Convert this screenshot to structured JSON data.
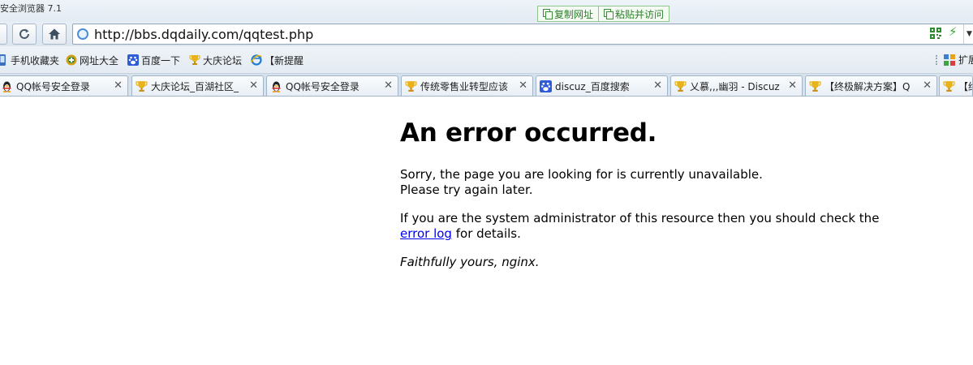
{
  "browser": {
    "title": "安全浏览器 7.1",
    "copy_url_label": "复制网址",
    "paste_go_label": "粘贴并访问",
    "url": "http://bbs.dqdaily.com/qqtest.php"
  },
  "favorites": {
    "items": [
      {
        "label": "手机收藏夹",
        "icon": "phone-icon"
      },
      {
        "label": "网址大全",
        "icon": "site-directory-icon"
      },
      {
        "label": "百度一下",
        "icon": "baidu-paw-icon"
      },
      {
        "label": "大庆论坛",
        "icon": "trophy-icon"
      },
      {
        "label": "【新提醒",
        "icon": "ie-icon"
      }
    ],
    "extend_label": "扩展"
  },
  "tabs": [
    {
      "label": "QQ帐号安全登录",
      "icon": "qq-penguin-icon"
    },
    {
      "label": "大庆论坛_百湖社区_",
      "icon": "trophy-icon"
    },
    {
      "label": "QQ帐号安全登录",
      "icon": "qq-penguin-icon"
    },
    {
      "label": "传统零售业转型应该",
      "icon": "trophy-icon"
    },
    {
      "label": "discuz_百度搜索",
      "icon": "baidu-paw-icon"
    },
    {
      "label": "乂慕,,,幽羽 - Discuz",
      "icon": "trophy-icon"
    },
    {
      "label": "【终极解决方案】Q",
      "icon": "trophy-icon"
    },
    {
      "label": "【终",
      "icon": "trophy-icon"
    }
  ],
  "page": {
    "title": "An error occurred.",
    "line1": "Sorry, the page you are looking for is currently unavailable.",
    "line2": "Please try again later.",
    "admin_text_before": "If you are the system administrator of this resource then you should check the",
    "link_text": "error log",
    "admin_text_after": "for details.",
    "signature": "Faithfully yours, nginx."
  }
}
